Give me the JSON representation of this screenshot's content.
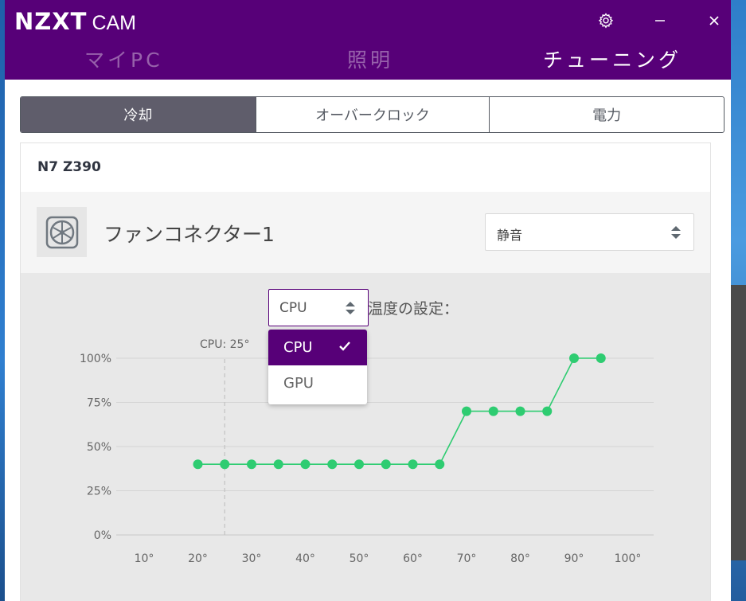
{
  "app": {
    "logo_main": "NZXT",
    "logo_sub": "CAM"
  },
  "main_tabs": [
    {
      "label": "マイPC",
      "active": false
    },
    {
      "label": "照明",
      "active": false
    },
    {
      "label": "チューニング",
      "active": true
    }
  ],
  "sub_tabs": [
    {
      "label": "冷却",
      "active": true
    },
    {
      "label": "オーバークロック",
      "active": false
    },
    {
      "label": "電力",
      "active": false
    }
  ],
  "device": {
    "name": "N7 Z390"
  },
  "fan": {
    "label": "ファンコネクター1",
    "icon": "fan-icon",
    "preset": "静音"
  },
  "temp_source": {
    "selected": "CPU",
    "setting_label": "温度の設定：",
    "options": [
      "CPU",
      "GPU"
    ]
  },
  "colors": {
    "brand": "#570078",
    "curve": "#2ecc71",
    "tab_active": "#5f5d6b"
  },
  "chart_data": {
    "type": "line",
    "x": [
      20,
      25,
      30,
      35,
      40,
      45,
      50,
      55,
      60,
      65,
      70,
      75,
      80,
      85,
      90,
      95
    ],
    "y": [
      40,
      40,
      40,
      40,
      40,
      40,
      40,
      40,
      40,
      40,
      70,
      70,
      70,
      70,
      100,
      100
    ],
    "x_ticks": [
      "10°",
      "20°",
      "30°",
      "40°",
      "50°",
      "60°",
      "70°",
      "80°",
      "90°",
      "100°"
    ],
    "y_ticks": [
      "0%",
      "25%",
      "50%",
      "75%",
      "100%"
    ],
    "xlim": [
      10,
      100
    ],
    "ylim": [
      0,
      100
    ],
    "grid": true,
    "marker_label": "CPU: 25°",
    "marker_x": 25
  }
}
